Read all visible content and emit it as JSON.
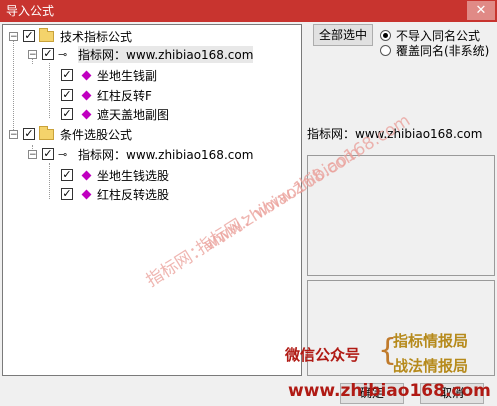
{
  "window": {
    "title": "导入公式",
    "close_label": "✕"
  },
  "tree": {
    "group1": {
      "label": "技术指标公式",
      "expander": "−",
      "checked": "✓"
    },
    "group1_child": {
      "label": "指标网：www.zhibiao168.com",
      "expander": "−",
      "checked": "✓"
    },
    "group1_items": [
      {
        "label": "坐地生钱副",
        "checked": "✓"
      },
      {
        "label": "红柱反转F",
        "checked": "✓"
      },
      {
        "label": "遮天盖地副图",
        "checked": "✓"
      }
    ],
    "group2": {
      "label": "条件选股公式",
      "expander": "−",
      "checked": "✓"
    },
    "group2_child": {
      "label": "指标网：www.zhibiao168.com",
      "expander": "−",
      "checked": "✓"
    },
    "group2_items": [
      {
        "label": "坐地生钱选股",
        "checked": "✓"
      },
      {
        "label": "红柱反转选股",
        "checked": "✓"
      }
    ]
  },
  "actions": {
    "select_all": "全部选中",
    "ok": "确定",
    "cancel": "取消"
  },
  "options": {
    "no_import": "不导入同名公式",
    "overwrite": "覆盖同名(非系统)",
    "selected": "no_import"
  },
  "info_text": "指标网：www.zhibiao168.com",
  "watermark": {
    "text1": "指标网：www.zhibiao168.com",
    "text2": "指标网：www.zhibiao168.com"
  },
  "promo": {
    "wechat": "微信公众号",
    "name1": "指标情报局",
    "name2": "战法情报局",
    "url": "www.zhibiao168.com"
  }
}
